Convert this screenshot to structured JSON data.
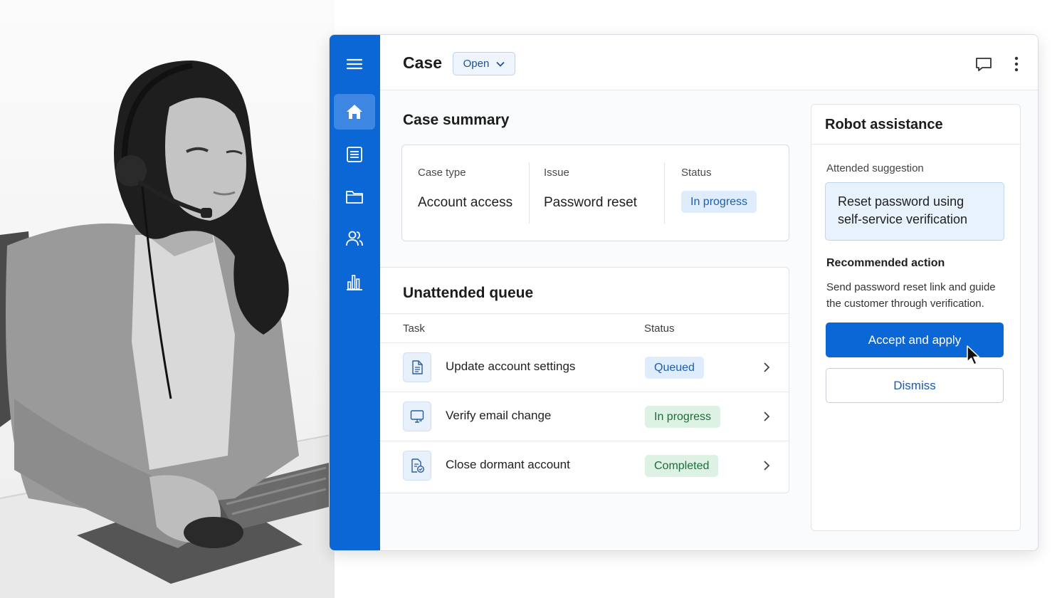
{
  "header": {
    "title": "Case",
    "status_dropdown": {
      "selected": "Open"
    }
  },
  "nav_rail": {
    "items": [
      {
        "icon": "home-icon",
        "active": true
      },
      {
        "icon": "list-icon",
        "active": false
      },
      {
        "icon": "folder-icon",
        "active": false
      },
      {
        "icon": "users-icon",
        "active": false
      },
      {
        "icon": "bar-chart-icon",
        "active": false
      }
    ]
  },
  "case_summary": {
    "title": "Case summary",
    "fields": [
      {
        "label": "Case type",
        "value": "Account access"
      },
      {
        "label": "Issue",
        "value": "Password reset"
      },
      {
        "label": "Status",
        "value": "In progress"
      }
    ]
  },
  "queue": {
    "title": "Unattended queue",
    "columns": [
      "Task",
      "Status"
    ],
    "rows": [
      {
        "task": "Update account settings",
        "status": "Queued",
        "icon": "document-icon"
      },
      {
        "task": "Verify email change",
        "status": "In progress",
        "icon": "monitor-icon"
      },
      {
        "task": "Close dormant account",
        "status": "Completed",
        "icon": "file-check-icon"
      }
    ]
  },
  "robot": {
    "title": "Robot assistance",
    "suggestion_label": "Attended suggestion",
    "suggestion_text": "Reset password using self-service verification",
    "recommended_label": "Recommended action",
    "recommended_text": "Send password reset link and guide the customer through verification.",
    "accept_label": "Accept and apply",
    "dismiss_label": "Dismiss"
  },
  "colors": {
    "brand_blue": "#0b66d6",
    "badge_blue_bg": "#deecfb",
    "badge_green_bg": "#ddf1e4"
  }
}
